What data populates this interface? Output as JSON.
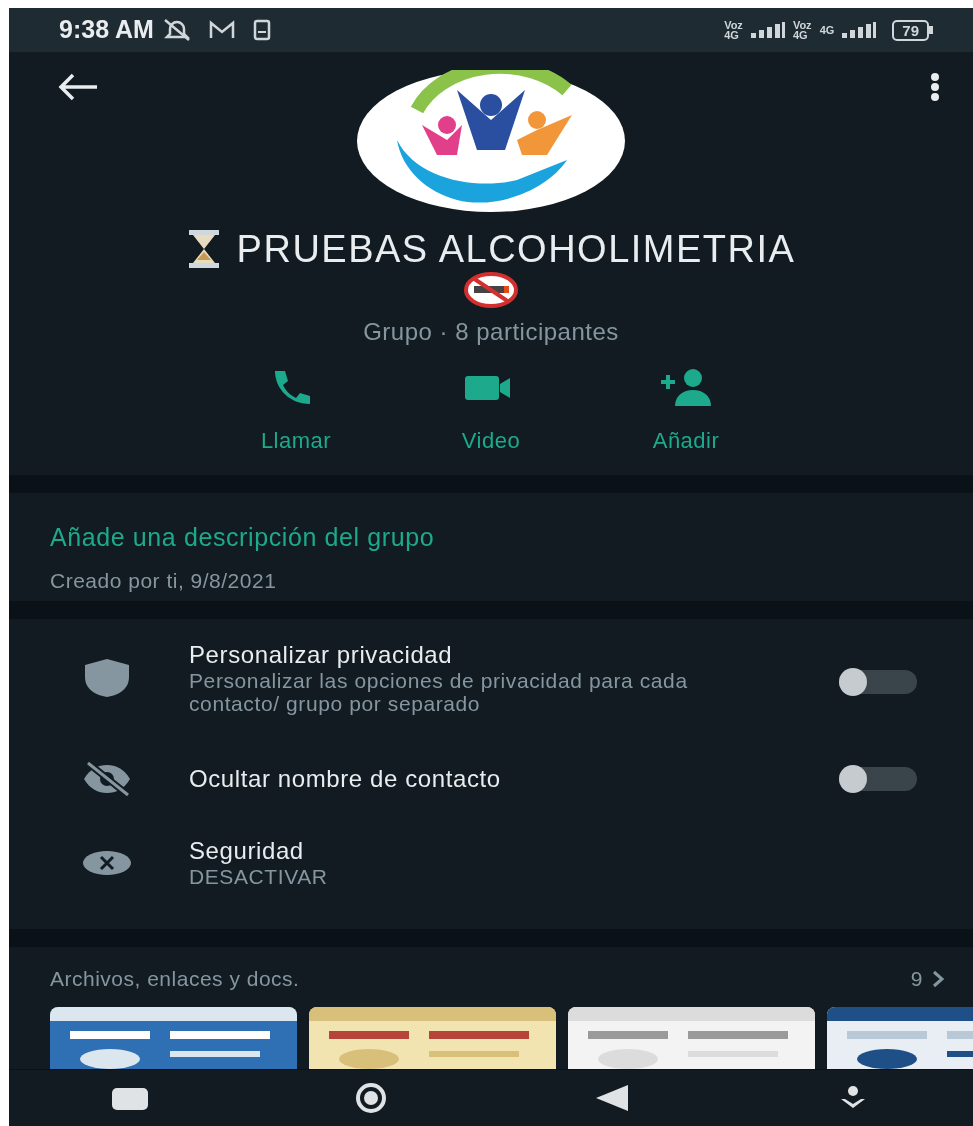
{
  "status_bar": {
    "time": "9:38 AM",
    "sims": [
      {
        "top": "Voz",
        "bottom": "4G"
      },
      {
        "top": "Voz",
        "bottom": "4G"
      }
    ],
    "network": "4G",
    "battery": "79"
  },
  "header": {
    "group_name": "PRUEBAS ALCOHOLIMETRIA",
    "subtitle": "Grupo · 8 participantes",
    "actions": [
      {
        "kind": "call",
        "label": "Llamar"
      },
      {
        "kind": "video",
        "label": "Video"
      },
      {
        "kind": "add",
        "label": "Añadir"
      }
    ]
  },
  "description": {
    "link": "Añade una descripción del grupo",
    "created": "Creado por ti, 9/8/2021"
  },
  "settings": [
    {
      "kind": "toggle",
      "title": "Personalizar privacidad",
      "subtitle": "Personalizar las opciones de privacidad para cada contacto/ grupo por separado",
      "on": false
    },
    {
      "kind": "toggle",
      "title": "Ocultar nombre de contacto",
      "on": false
    },
    {
      "kind": "info",
      "title": "Seguridad",
      "subtitle": "DESACTIVAR"
    }
  ],
  "media": {
    "title": "Archivos, enlaces y docs.",
    "count": "9"
  }
}
